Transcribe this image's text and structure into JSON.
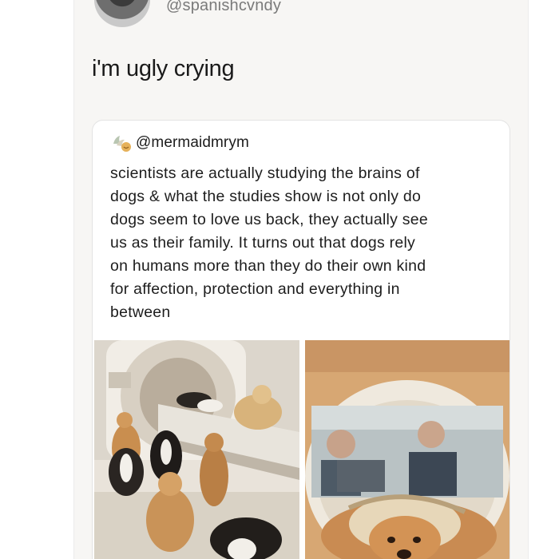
{
  "author": {
    "handle": "@spanishcvndy",
    "avatar_icon": "profile-avatar"
  },
  "tweet": {
    "text": "i'm ugly crying"
  },
  "quoted": {
    "handle": "@mermaidmrym",
    "header_icon": "emoji-icon",
    "lines": [
      "scientists are actually studying the brains of",
      "dogs & what the studies show is not only do",
      "dogs seem to love us back, they actually see",
      "us as their family. It turns out that dogs rely",
      "on humans more than they do their own kind",
      "for affection, protection and everything in",
      "between"
    ]
  },
  "colors": {
    "card_bg": "#f7f6f4",
    "quote_bg": "#ffffff",
    "text": "#1a1a1a",
    "handle": "#7a7a7a"
  }
}
